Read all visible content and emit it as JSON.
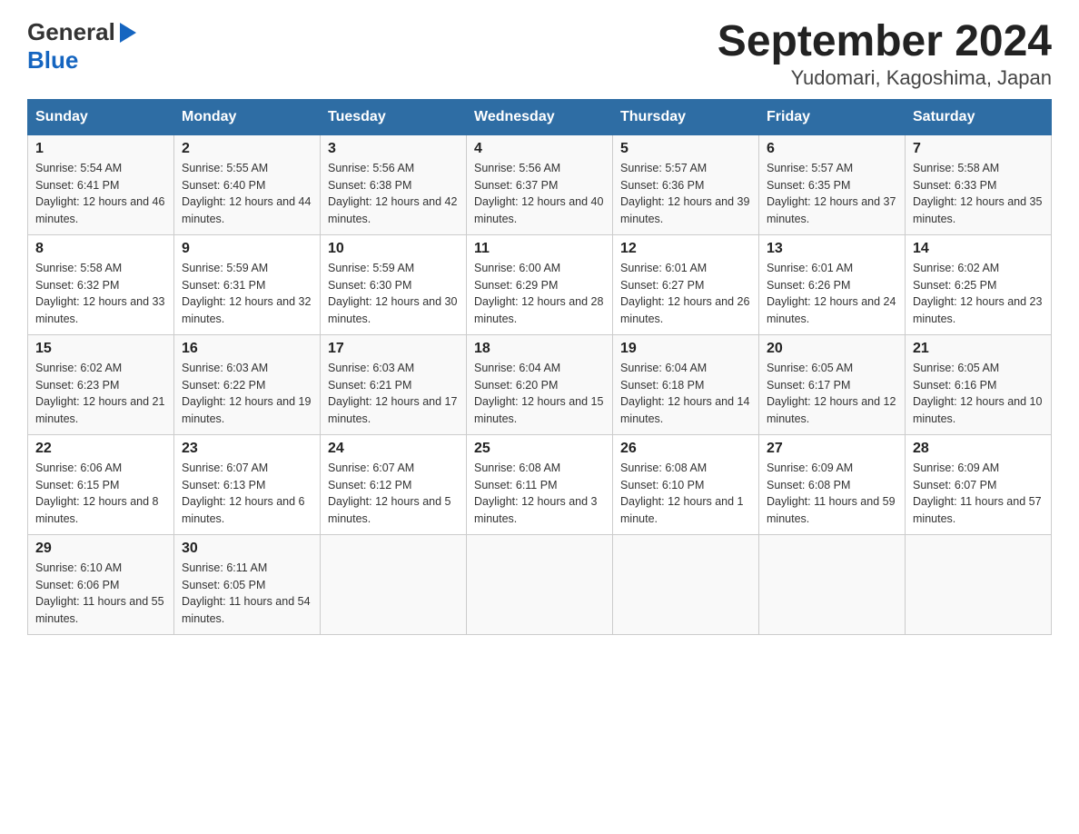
{
  "logo": {
    "general": "General",
    "blue": "Blue"
  },
  "title": "September 2024",
  "subtitle": "Yudomari, Kagoshima, Japan",
  "days_of_week": [
    "Sunday",
    "Monday",
    "Tuesday",
    "Wednesday",
    "Thursday",
    "Friday",
    "Saturday"
  ],
  "weeks": [
    [
      {
        "day": "1",
        "sunrise": "5:54 AM",
        "sunset": "6:41 PM",
        "daylight": "12 hours and 46 minutes."
      },
      {
        "day": "2",
        "sunrise": "5:55 AM",
        "sunset": "6:40 PM",
        "daylight": "12 hours and 44 minutes."
      },
      {
        "day": "3",
        "sunrise": "5:56 AM",
        "sunset": "6:38 PM",
        "daylight": "12 hours and 42 minutes."
      },
      {
        "day": "4",
        "sunrise": "5:56 AM",
        "sunset": "6:37 PM",
        "daylight": "12 hours and 40 minutes."
      },
      {
        "day": "5",
        "sunrise": "5:57 AM",
        "sunset": "6:36 PM",
        "daylight": "12 hours and 39 minutes."
      },
      {
        "day": "6",
        "sunrise": "5:57 AM",
        "sunset": "6:35 PM",
        "daylight": "12 hours and 37 minutes."
      },
      {
        "day": "7",
        "sunrise": "5:58 AM",
        "sunset": "6:33 PM",
        "daylight": "12 hours and 35 minutes."
      }
    ],
    [
      {
        "day": "8",
        "sunrise": "5:58 AM",
        "sunset": "6:32 PM",
        "daylight": "12 hours and 33 minutes."
      },
      {
        "day": "9",
        "sunrise": "5:59 AM",
        "sunset": "6:31 PM",
        "daylight": "12 hours and 32 minutes."
      },
      {
        "day": "10",
        "sunrise": "5:59 AM",
        "sunset": "6:30 PM",
        "daylight": "12 hours and 30 minutes."
      },
      {
        "day": "11",
        "sunrise": "6:00 AM",
        "sunset": "6:29 PM",
        "daylight": "12 hours and 28 minutes."
      },
      {
        "day": "12",
        "sunrise": "6:01 AM",
        "sunset": "6:27 PM",
        "daylight": "12 hours and 26 minutes."
      },
      {
        "day": "13",
        "sunrise": "6:01 AM",
        "sunset": "6:26 PM",
        "daylight": "12 hours and 24 minutes."
      },
      {
        "day": "14",
        "sunrise": "6:02 AM",
        "sunset": "6:25 PM",
        "daylight": "12 hours and 23 minutes."
      }
    ],
    [
      {
        "day": "15",
        "sunrise": "6:02 AM",
        "sunset": "6:23 PM",
        "daylight": "12 hours and 21 minutes."
      },
      {
        "day": "16",
        "sunrise": "6:03 AM",
        "sunset": "6:22 PM",
        "daylight": "12 hours and 19 minutes."
      },
      {
        "day": "17",
        "sunrise": "6:03 AM",
        "sunset": "6:21 PM",
        "daylight": "12 hours and 17 minutes."
      },
      {
        "day": "18",
        "sunrise": "6:04 AM",
        "sunset": "6:20 PM",
        "daylight": "12 hours and 15 minutes."
      },
      {
        "day": "19",
        "sunrise": "6:04 AM",
        "sunset": "6:18 PM",
        "daylight": "12 hours and 14 minutes."
      },
      {
        "day": "20",
        "sunrise": "6:05 AM",
        "sunset": "6:17 PM",
        "daylight": "12 hours and 12 minutes."
      },
      {
        "day": "21",
        "sunrise": "6:05 AM",
        "sunset": "6:16 PM",
        "daylight": "12 hours and 10 minutes."
      }
    ],
    [
      {
        "day": "22",
        "sunrise": "6:06 AM",
        "sunset": "6:15 PM",
        "daylight": "12 hours and 8 minutes."
      },
      {
        "day": "23",
        "sunrise": "6:07 AM",
        "sunset": "6:13 PM",
        "daylight": "12 hours and 6 minutes."
      },
      {
        "day": "24",
        "sunrise": "6:07 AM",
        "sunset": "6:12 PM",
        "daylight": "12 hours and 5 minutes."
      },
      {
        "day": "25",
        "sunrise": "6:08 AM",
        "sunset": "6:11 PM",
        "daylight": "12 hours and 3 minutes."
      },
      {
        "day": "26",
        "sunrise": "6:08 AM",
        "sunset": "6:10 PM",
        "daylight": "12 hours and 1 minute."
      },
      {
        "day": "27",
        "sunrise": "6:09 AM",
        "sunset": "6:08 PM",
        "daylight": "11 hours and 59 minutes."
      },
      {
        "day": "28",
        "sunrise": "6:09 AM",
        "sunset": "6:07 PM",
        "daylight": "11 hours and 57 minutes."
      }
    ],
    [
      {
        "day": "29",
        "sunrise": "6:10 AM",
        "sunset": "6:06 PM",
        "daylight": "11 hours and 55 minutes."
      },
      {
        "day": "30",
        "sunrise": "6:11 AM",
        "sunset": "6:05 PM",
        "daylight": "11 hours and 54 minutes."
      },
      {
        "day": "",
        "sunrise": "",
        "sunset": "",
        "daylight": ""
      },
      {
        "day": "",
        "sunrise": "",
        "sunset": "",
        "daylight": ""
      },
      {
        "day": "",
        "sunrise": "",
        "sunset": "",
        "daylight": ""
      },
      {
        "day": "",
        "sunrise": "",
        "sunset": "",
        "daylight": ""
      },
      {
        "day": "",
        "sunrise": "",
        "sunset": "",
        "daylight": ""
      }
    ]
  ]
}
